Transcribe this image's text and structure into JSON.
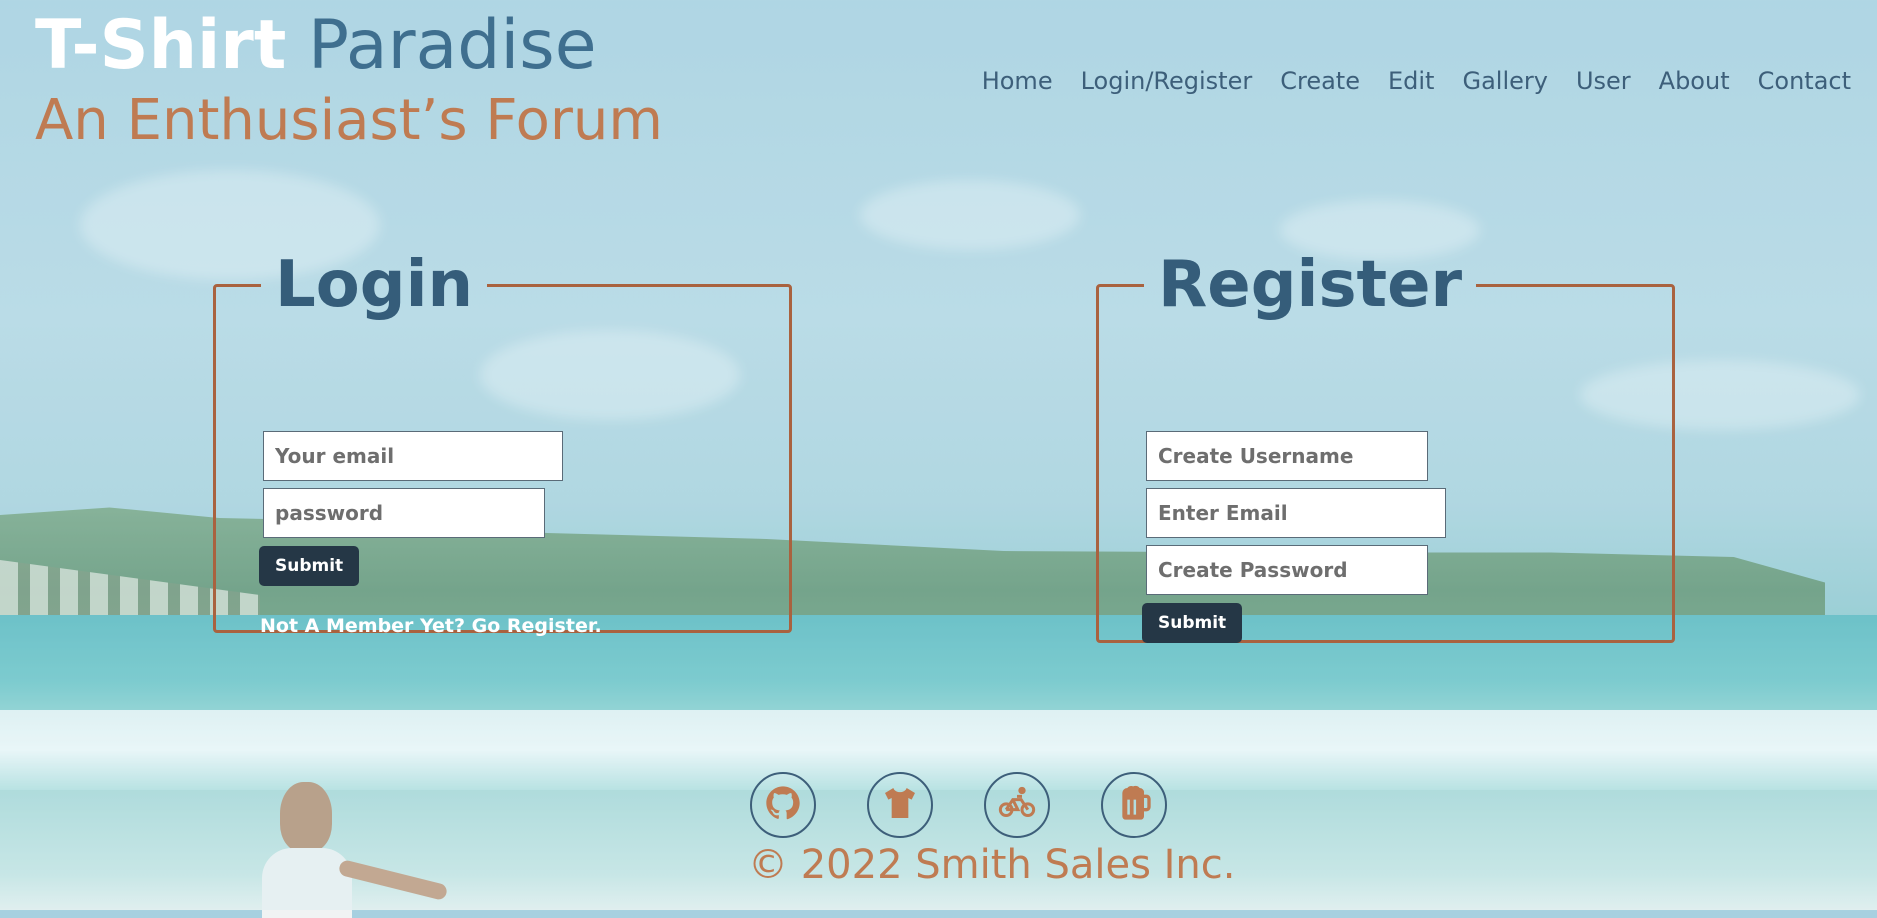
{
  "brand": {
    "title_part1": "T-Shirt",
    "title_part2": "Paradise",
    "subtitle": "An Enthusiast’s Forum"
  },
  "nav": {
    "items": [
      "Home",
      "Login/Register",
      "Create",
      "Edit",
      "Gallery",
      "User",
      "About",
      "Contact"
    ]
  },
  "login": {
    "legend": "Login",
    "email_placeholder": "Your email",
    "password_placeholder": "password",
    "submit_label": "Submit",
    "register_prompt": "Not A Member Yet? Go Register."
  },
  "register": {
    "legend": "Register",
    "username_placeholder": "Create Username",
    "email_placeholder": "Enter Email",
    "password_placeholder": "Create Password",
    "submit_label": "Submit"
  },
  "footer": {
    "icons": [
      "github-icon",
      "tshirt-icon",
      "bicycle-icon",
      "beer-mug-icon"
    ],
    "copyright": "© 2022 Smith Sales Inc."
  },
  "colors": {
    "accent": "#bf7b52",
    "primary": "#3d5f7a",
    "border": "#a9623f",
    "button": "#253746"
  }
}
